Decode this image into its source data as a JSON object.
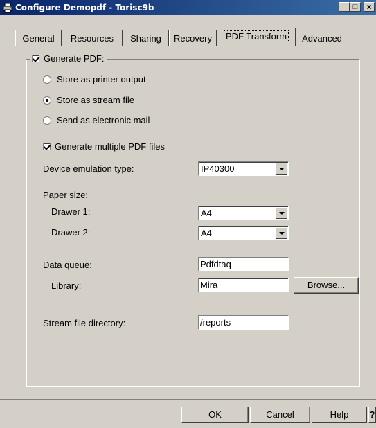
{
  "window": {
    "title": "Configure Demopdf - Torisc9b",
    "minimize": "_",
    "maximize": "□",
    "close": "x"
  },
  "tabs": [
    {
      "label": "General"
    },
    {
      "label": "Resources"
    },
    {
      "label": "Sharing"
    },
    {
      "label": "Recovery"
    },
    {
      "label": "PDF Transform",
      "active": true
    },
    {
      "label": "Advanced"
    }
  ],
  "group": {
    "generate_pdf": {
      "label": "Generate PDF:",
      "checked": true
    }
  },
  "output": {
    "printer": {
      "label": "Store as printer output",
      "selected": false
    },
    "stream": {
      "label": "Store as stream file",
      "selected": true
    },
    "email": {
      "label": "Send as electronic mail",
      "selected": false
    }
  },
  "multiple_pdf": {
    "label": "Generate multiple PDF files",
    "checked": true
  },
  "device": {
    "label": "Device emulation type:",
    "value": "IP40300"
  },
  "paper": {
    "label": "Paper size:",
    "drawer1": {
      "label": "Drawer 1:",
      "value": "A4"
    },
    "drawer2": {
      "label": "Drawer 2:",
      "value": "A4"
    }
  },
  "data_queue": {
    "label": "Data queue:",
    "value": "Pdfdtaq"
  },
  "library": {
    "label": "Library:",
    "value": "Mira",
    "browse": "Browse..."
  },
  "stream_dir": {
    "label": "Stream file directory:",
    "value": "/reports"
  },
  "buttons": {
    "ok": "OK",
    "cancel": "Cancel",
    "help": "Help",
    "whatsthis": "?"
  }
}
